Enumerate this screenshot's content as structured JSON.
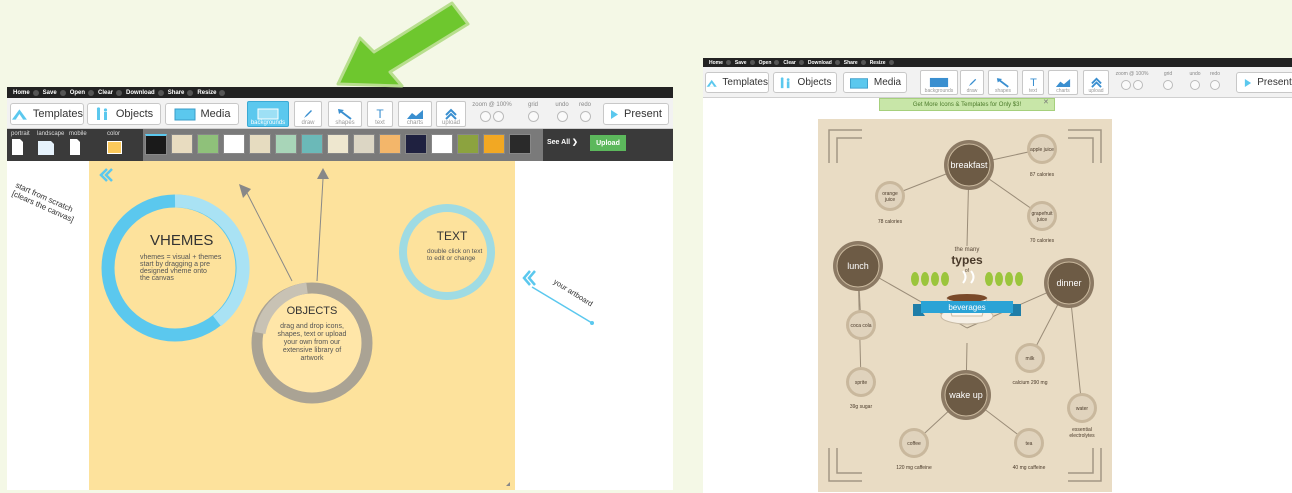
{
  "colors": {
    "background": "#f4f8e6",
    "menubar": "#222222",
    "artboard": "#fde29c",
    "accent_blue": "#5bc8ee",
    "upload_green": "#5cb85c",
    "arrow_green": "#6ec72e"
  },
  "left_app": {
    "menu": [
      "Home",
      "Save",
      "Open",
      "Clear",
      "Download",
      "Share",
      "Resize"
    ],
    "toolbar": {
      "templates": "Templates",
      "objects": "Objects",
      "media": "Media",
      "tools": [
        "backgrounds",
        "draw",
        "shapes",
        "text",
        "charts",
        "upload"
      ],
      "active_tool": "backgrounds",
      "zoom_label": "zoom @ 100%",
      "grid_label": "grid",
      "undo_label": "undo",
      "redo_label": "redo",
      "present": "Present"
    },
    "bg_strip": {
      "orientation_labels": [
        "portrait",
        "landscape",
        "mobile"
      ],
      "color_label": "color",
      "see_all": "See All ❯",
      "upload": "Upload",
      "swatches": [
        "#1a1a1a",
        "#e8dcc0",
        "#8fc17a",
        "#ffffff",
        "#e6dcc0",
        "#a8d5b8",
        "#6bb9b8",
        "#eee7cf",
        "#dcd6c4",
        "#f3b66a",
        "#1f2140",
        "#ffffff",
        "#8ca33f",
        "#f2a823",
        "#2a2a2a"
      ]
    },
    "canvas": {
      "hint_scratch_line1": "start from scratch",
      "hint_scratch_line2": "[clears the canvas]",
      "hint_artboard": "your artboard",
      "vhemes_title": "VHEMES",
      "vhemes_text": [
        "vhemes = visual + themes",
        "start by dragging a pre",
        "designed vheme onto",
        "the canvas"
      ],
      "objects_title": "OBJECTS",
      "objects_text": [
        "drag and drop icons,",
        "shapes, text or upload",
        "your own from our",
        "extensive library of",
        "artwork"
      ],
      "text_title": "TEXT",
      "text_text": [
        "double click on text",
        "to edit or change"
      ]
    }
  },
  "right_app": {
    "menu": [
      "Home",
      "Save",
      "Open",
      "Clear",
      "Download",
      "Share",
      "Resize"
    ],
    "toolbar": {
      "templates": "Templates",
      "objects": "Objects",
      "media": "Media",
      "tools": [
        "backgrounds",
        "draw",
        "shapes",
        "text",
        "charts",
        "upload"
      ],
      "zoom_label": "zoom @ 100%",
      "grid_label": "grid",
      "undo_label": "undo",
      "redo_label": "redo",
      "present": "Present"
    },
    "promo": "Get More Icons & Templates for Only $3!",
    "promo_close": "✕",
    "infographic": {
      "title_small": "the many",
      "title_big": "types",
      "title_of": "of",
      "banner": "beverages",
      "hubs": {
        "breakfast": "breakfast",
        "lunch": "lunch",
        "dinner": "dinner",
        "wakeup": "wake up"
      },
      "items": {
        "apple_name": "apple juice",
        "apple_cal": "87 calories",
        "orange_name_1": "orange",
        "orange_name_2": "juice",
        "orange_cal": "78 calories",
        "grape_name_1": "grapefruit",
        "grape_name_2": "juice",
        "grape_cal": "70 calories",
        "cola_name": "coca cola",
        "sprite_name": "sprite",
        "sprite_cal": "39g sugar",
        "milk_name": "milk",
        "milk_cal": "calcium 290 mg",
        "water_name": "water",
        "water_cal_1": "essential",
        "water_cal_2": "electrolytes",
        "coffee_name": "coffee",
        "coffee_cal": "120 mg caffeine",
        "tea_name": "tea",
        "tea_cal": "40 mg caffeine"
      }
    }
  }
}
